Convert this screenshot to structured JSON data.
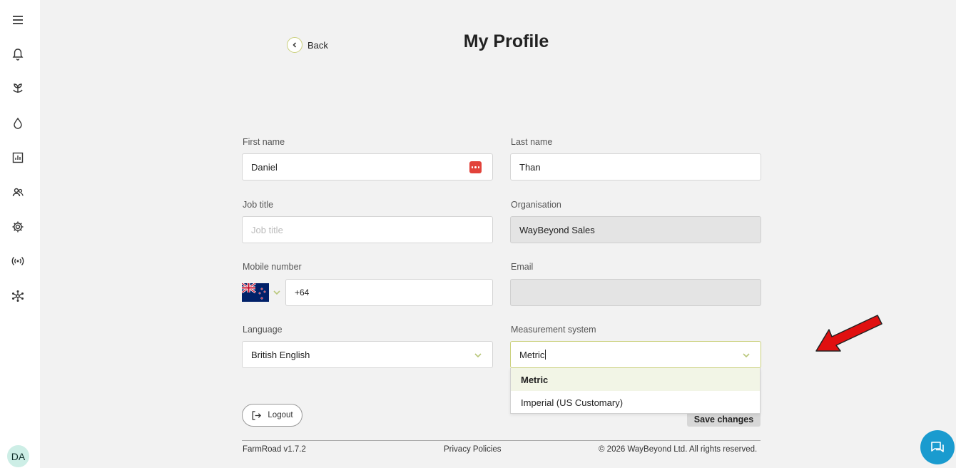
{
  "sidebar": {
    "icons": [
      "menu-icon",
      "bell-icon",
      "plant-icon",
      "water-drop-icon",
      "chart-icon",
      "users-icon",
      "gear-icon",
      "broadcast-icon",
      "network-icon"
    ],
    "avatar_initials": "DA"
  },
  "header": {
    "back_label": "Back",
    "title": "My Profile"
  },
  "form": {
    "first_name": {
      "label": "First name",
      "value": "Daniel"
    },
    "last_name": {
      "label": "Last name",
      "value": "Than"
    },
    "job_title": {
      "label": "Job title",
      "placeholder": "Job title"
    },
    "organisation": {
      "label": "Organisation",
      "value": "WayBeyond Sales"
    },
    "mobile": {
      "label": "Mobile number",
      "value": "+64",
      "country": "New Zealand"
    },
    "email": {
      "label": "Email",
      "value": ""
    },
    "language": {
      "label": "Language",
      "value": "British English"
    },
    "measurement": {
      "label": "Measurement system",
      "value": "Metric",
      "options": [
        "Metric",
        "Imperial (US Customary)"
      ],
      "highlighted": "Metric"
    }
  },
  "actions": {
    "logout_label": "Logout",
    "save_label": "Save changes"
  },
  "footer": {
    "version": "FarmRoad v1.7.2",
    "privacy": "Privacy Policies",
    "copyright": "© 2026 WayBeyond Ltd. All rights reserved."
  },
  "colors": {
    "accent_outline": "#c9cf7a",
    "chevron": "#b9c77a",
    "annotation_arrow": "#e01010",
    "chat_button": "#1a9bcf",
    "avatar_bg": "#cdeee6"
  }
}
